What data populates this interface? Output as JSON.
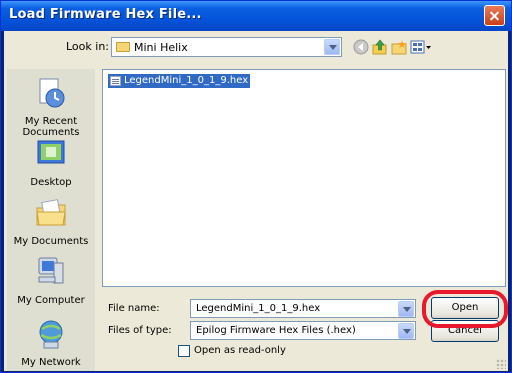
{
  "window": {
    "title": "Load Firmware Hex File..."
  },
  "lookin": {
    "label": "Look in:",
    "value": "Mini Helix"
  },
  "places": [
    {
      "label": "My Recent\nDocuments"
    },
    {
      "label": "Desktop"
    },
    {
      "label": "My Documents"
    },
    {
      "label": "My Computer"
    },
    {
      "label": "My Network"
    }
  ],
  "files": [
    {
      "name": "LegendMini_1_0_1_9.hex",
      "selected": true
    }
  ],
  "filename": {
    "label": "File name:",
    "value": "LegendMini_1_0_1_9.hex"
  },
  "filetype": {
    "label": "Files of type:",
    "value": "Epilog Firmware Hex Files (.hex)"
  },
  "readonly": {
    "label": "Open as read-only",
    "checked": false
  },
  "buttons": {
    "open": "Open",
    "cancel": "Cancel"
  },
  "colors": {
    "title_bar": "#0454d9",
    "selection": "#316ac5",
    "highlight_ring": "#e8192c"
  }
}
